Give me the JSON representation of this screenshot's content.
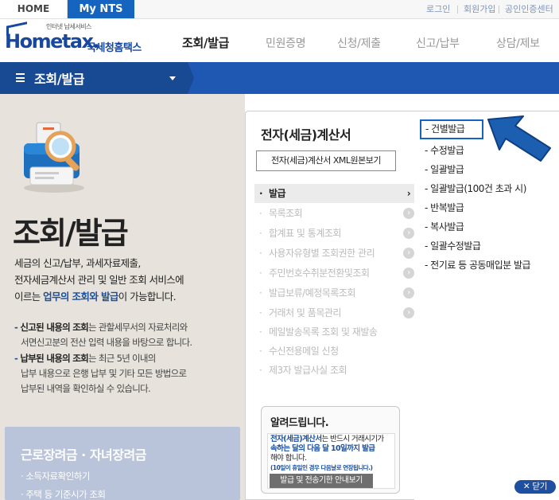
{
  "topbar": {
    "home_tab": "HOME",
    "mynts_tab": "My NTS",
    "links": [
      "로그인",
      "회원가입",
      "공인인증센터"
    ]
  },
  "header": {
    "logo_tagline": "인터넷 납세서비스",
    "logo_text": "Hometax.",
    "logo_korean": "국세청홈택스",
    "nav": [
      "조회/발급",
      "민원증명",
      "신청/제출",
      "신고/납부",
      "상담/제보"
    ],
    "active_nav_index": 0
  },
  "titlebar": {
    "label": "조회/발급"
  },
  "left": {
    "title": "조회/발급",
    "intro_line1": "세금의 신고/납부, 과세자료제출,",
    "intro_line2": "전자세금계산서 관리 및 일반 조회 서비스에",
    "intro_line3_pre": "이르는 ",
    "intro_line3_hl": "업무의 조회와 발급",
    "intro_line3_post": "이 가능합니다.",
    "bullet1_em": "신고된 내용의 조회",
    "bullet1_rest": "는 관할세무서의 자료처리와",
    "bullet1_line2": "서면신고분의 전산 입력 내용을 바탕으로 합니다.",
    "bullet2_em": "납부된 내용의 조회",
    "bullet2_rest": "는 최근 5년 이내의",
    "bullet2_line2": "납부 내용으로 은행 납부 및 기타 모든 방법으로",
    "bullet2_line3": "납부된 내역을 확인하실 수 있습니다.",
    "promo_title": "근로장려금 · 자녀장려금",
    "promo_items": [
      "소득자료확인하기",
      "주택 등 기준시가 조회"
    ]
  },
  "middle": {
    "title": "전자(세금)계산서",
    "xml_button": "전자(세금)계산서 XML원본보기",
    "menu": [
      {
        "label": "발급",
        "active": true
      },
      {
        "label": "목록조회",
        "active": false
      },
      {
        "label": "합계표 및 통계조회",
        "active": false
      },
      {
        "label": "사용자유형별 조회권한 관리",
        "active": false
      },
      {
        "label": "주민번호수취분전환및조회",
        "active": false
      },
      {
        "label": "발급보류/예정목록조회",
        "active": false
      },
      {
        "label": "거래처 및 품목관리",
        "active": false
      },
      {
        "label": "메일발송목록 조회 및 재발송",
        "active": false
      },
      {
        "label": "수신전용메일 신청",
        "active": false
      },
      {
        "label": "제3자 발급사실 조회",
        "active": false
      }
    ],
    "notice": {
      "title": "알려드립니다.",
      "text_hl": "전자(세금)계산서",
      "text_1": "는 반드시 거래시기가",
      "text_2_hl": "속하는 달의 다음 달 10일까지 발급",
      "text_3": "해야 합니다.",
      "small": "(10일이 휴일인 경우 다음날로 연장됩니다.)",
      "button": "발급 및 전송기한 안내보기"
    }
  },
  "right": {
    "submenu": [
      "건별발급",
      "수정발급",
      "일괄발급",
      "일괄발급(100건 초과 시)",
      "반복발급",
      "복사발급",
      "일괄수정발급",
      "전기료 등 공동매입분 발급"
    ],
    "selected_index": 0
  },
  "close_button": "닫기",
  "colors": {
    "brand_blue": "#1565c0",
    "titlebar_blue": "#1f58b2",
    "left_bg": "#e7e3dc"
  }
}
